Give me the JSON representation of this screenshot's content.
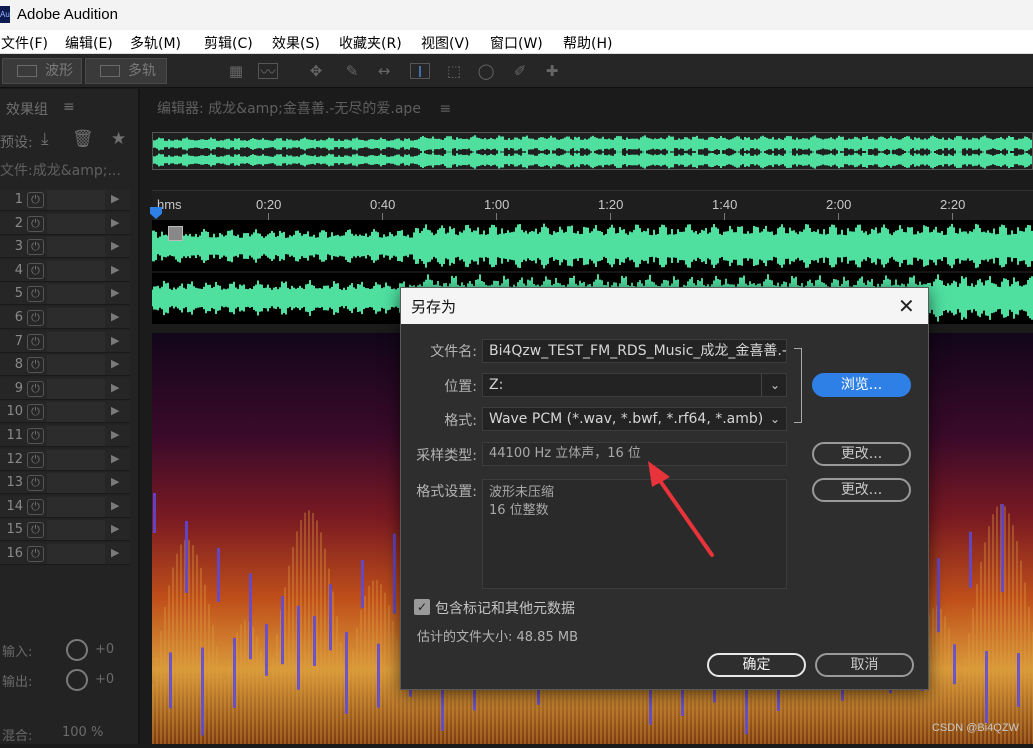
{
  "app": {
    "logo_text": "Au",
    "title": "Adobe Audition"
  },
  "menu": [
    "文件(F)",
    "编辑(E)",
    "多轨(M)",
    "剪辑(C)",
    "效果(S)",
    "收藏夹(R)",
    "视图(V)",
    "窗口(W)",
    "帮助(H)"
  ],
  "toolbar": {
    "waveform_label": "波形",
    "multitrack_label": "多轨"
  },
  "effects_panel": {
    "title": "效果组",
    "menu_glyph": "≡",
    "preset_label": "预设:",
    "file_label": "文件:成龙&amp;...",
    "rack_numbers": [
      "1",
      "2",
      "3",
      "4",
      "5",
      "6",
      "7",
      "8",
      "9",
      "10",
      "11",
      "12",
      "13",
      "14",
      "15",
      "16"
    ],
    "input_label": "输入:",
    "output_label": "输出:",
    "input_value": "+0",
    "output_value": "+0",
    "mix_label": "混合:",
    "mix_value": "100 %"
  },
  "editor": {
    "tab_label": "编辑器: 成龙&amp;金喜善.-无尽的爱.ape",
    "menu_glyph": "≡",
    "ruler_unit": "hms",
    "ruler_ticks": [
      "0:20",
      "0:40",
      "1:00",
      "1:20",
      "1:40",
      "2:00",
      "2:20"
    ]
  },
  "dialog": {
    "title": "另存为",
    "close_glyph": "✕",
    "filename_label": "文件名:",
    "filename_value": "Bi4Qzw_TEST_FM_RDS_Music_成龙_金喜善.-",
    "location_label": "位置:",
    "location_value": "Z:",
    "format_label": "格式:",
    "format_value": "Wave PCM (*.wav, *.bwf, *.rf64, *.amb)",
    "browse_button": "浏览...",
    "sample_type_label": "采样类型:",
    "sample_type_value": "44100 Hz 立体声，16 位",
    "change_button_1": "更改...",
    "format_settings_label": "格式设置:",
    "format_settings_lines": [
      "波形未压缩",
      "16 位整数"
    ],
    "change_button_2": "更改...",
    "include_markers_label": "包含标记和其他元数据",
    "include_markers_checked": true,
    "estimated_size": "估计的文件大小: 48.85 MB",
    "ok_button": "确定",
    "cancel_button": "取消"
  },
  "watermark": "CSDN @Bi4QZW",
  "colors": {
    "waveform": "#4fe0a0",
    "accent_blue": "#2f80e6",
    "annotation_arrow": "#e8333a"
  }
}
